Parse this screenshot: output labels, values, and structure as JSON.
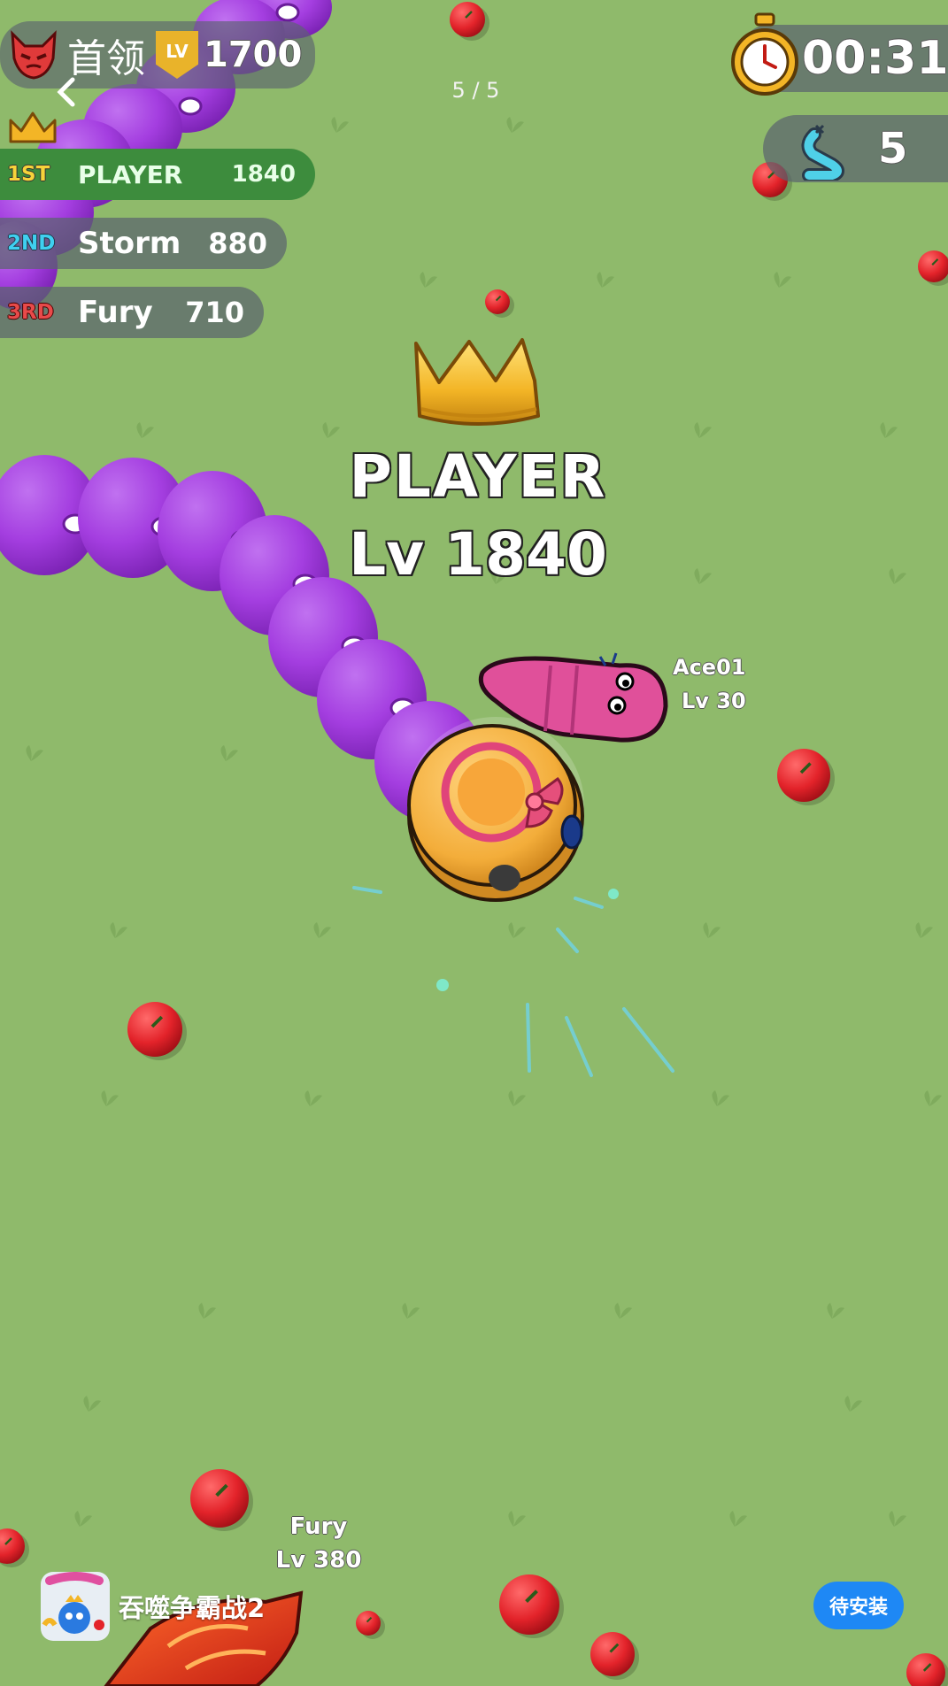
{
  "boss": {
    "label": "首领",
    "level_badge": "LV",
    "level": "1700"
  },
  "pager": "5 / 5",
  "timer": "00:31",
  "kills": "5",
  "leaderboard": [
    {
      "rank": "1ST",
      "name": "PLAYER",
      "score": "1840"
    },
    {
      "rank": "2ND",
      "name": "Storm",
      "score": "880"
    },
    {
      "rank": "3RD",
      "name": "Fury",
      "score": "710"
    }
  ],
  "player": {
    "name": "PLAYER",
    "level": "Lv 1840"
  },
  "enemies": [
    {
      "name": "Ace01",
      "level": "Lv 30"
    },
    {
      "name": "Fury",
      "level": "Lv 380"
    }
  ],
  "ad": {
    "app_name": "吞噬争霸战2",
    "install_label": "待安装"
  },
  "colors": {
    "grass": "#8fba6b",
    "purple_snake": "#a43ee0",
    "pink_worm": "#e0509a",
    "rank1": "#3d8c3d",
    "install": "#1e88f5"
  }
}
